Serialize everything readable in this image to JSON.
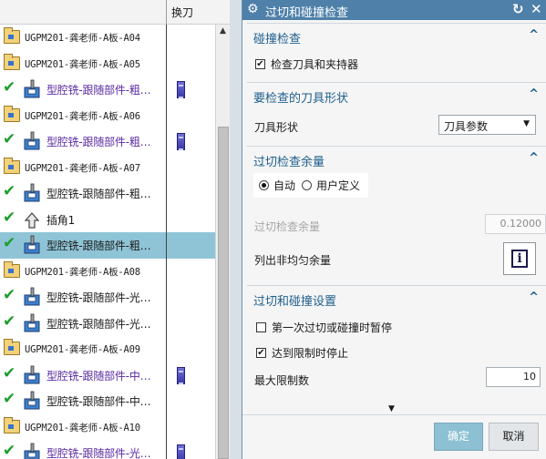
{
  "navigator": {
    "column_tool": "换刀",
    "rows": [
      {
        "type": "group",
        "name": "UGPM201-龚老师-A板-A04",
        "tool": false,
        "selected": false
      },
      {
        "type": "group",
        "name": "UGPM201-龚老师-A板-A05",
        "tool": false,
        "selected": false
      },
      {
        "type": "op",
        "color": "purple",
        "name": "型腔铣-跟随部件-粗…",
        "tool": true,
        "selected": false
      },
      {
        "type": "group",
        "name": "UGPM201-龚老师-A板-A06",
        "tool": false,
        "selected": false
      },
      {
        "type": "op",
        "color": "purple",
        "name": "型腔铣-跟随部件-粗…",
        "tool": true,
        "selected": false
      },
      {
        "type": "group",
        "name": "UGPM201-龚老师-A板-A07",
        "tool": false,
        "selected": false
      },
      {
        "type": "op",
        "color": "black",
        "name": "型腔铣-跟随部件-粗…",
        "tool": false,
        "selected": false
      },
      {
        "type": "chamfer",
        "color": "black",
        "name": "插角1",
        "tool": false,
        "selected": false
      },
      {
        "type": "op",
        "color": "black",
        "name": "型腔铣-跟随部件-粗…",
        "tool": false,
        "selected": true
      },
      {
        "type": "group",
        "name": "UGPM201-龚老师-A板-A08",
        "tool": false,
        "selected": false
      },
      {
        "type": "op",
        "color": "black",
        "name": "型腔铣-跟随部件-光…",
        "tool": false,
        "selected": false
      },
      {
        "type": "op",
        "color": "black",
        "name": "型腔铣-跟随部件-光…",
        "tool": false,
        "selected": false
      },
      {
        "type": "group",
        "name": "UGPM201-龚老师-A板-A09",
        "tool": false,
        "selected": false
      },
      {
        "type": "op",
        "color": "purple",
        "name": "型腔铣-跟随部件-中…",
        "tool": true,
        "selected": false
      },
      {
        "type": "op",
        "color": "black",
        "name": "型腔铣-跟随部件-中…",
        "tool": false,
        "selected": false
      },
      {
        "type": "group",
        "name": "UGPM201-龚老师-A板-A10",
        "tool": false,
        "selected": false
      },
      {
        "type": "op",
        "color": "purple",
        "name": "型腔铣-跟随部件-光…",
        "tool": true,
        "selected": false
      }
    ]
  },
  "dialog": {
    "title": "过切和碰撞检查",
    "collision": {
      "header": "碰撞检查",
      "check_tool_holder": {
        "label": "检查刀具和夹持器",
        "checked": true
      }
    },
    "tool_shape": {
      "header": "要检查的刀具形状",
      "label": "刀具形状",
      "value": "刀具参数"
    },
    "gouge_stock": {
      "header": "过切检查余量",
      "auto_label": "自动",
      "user_label": "用户定义",
      "selected": "auto",
      "stock_label": "过切检查余量",
      "stock_value": "0.12000",
      "list_label": "列出非均匀余量"
    },
    "settings": {
      "header": "过切和碰撞设置",
      "pause_first": {
        "label": "第一次过切或碰撞时暂停",
        "checked": false
      },
      "stop_at_limit": {
        "label": "达到限制时停止",
        "checked": true
      },
      "max_limit_label": "最大限制数",
      "max_limit_value": "10"
    },
    "ok_label": "确定",
    "cancel_label": "取消"
  },
  "colors": {
    "titlebar": "#4e80a9",
    "section_header": "#1e5f8c",
    "selection": "#8fc4d6",
    "check_green": "#1e9d2e",
    "op_purple": "#5a2aa0"
  }
}
